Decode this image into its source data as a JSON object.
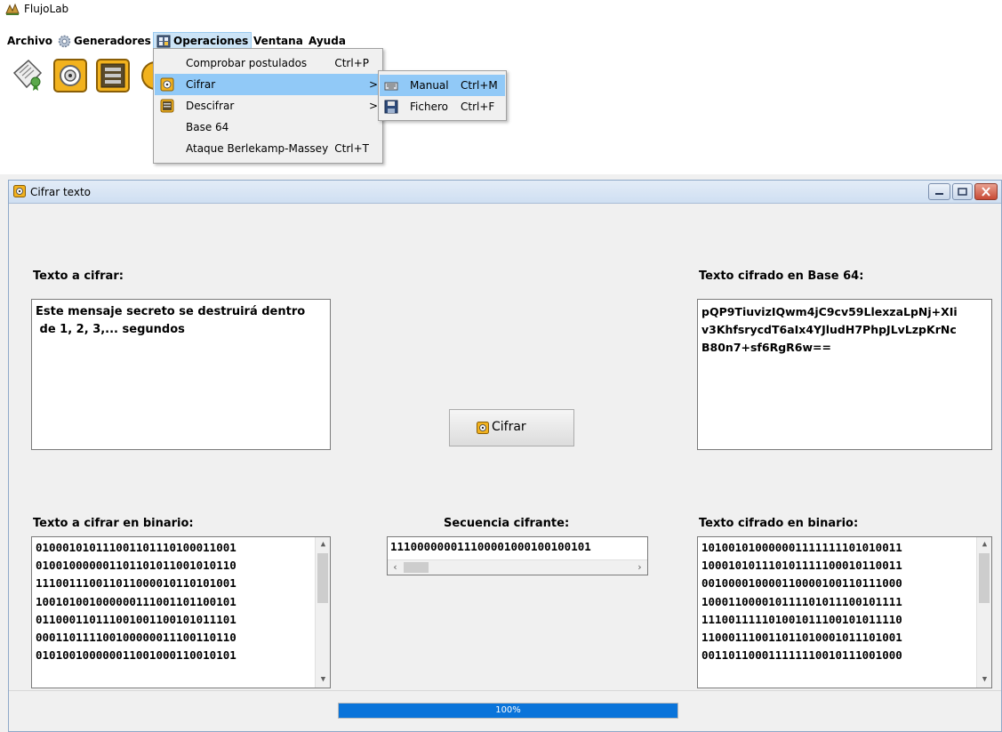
{
  "app": {
    "title": "FlujoLab"
  },
  "menubar": {
    "items": [
      {
        "label": "Archivo"
      },
      {
        "label": "Generadores"
      },
      {
        "label": "Operaciones"
      },
      {
        "label": "Ventana"
      },
      {
        "label": "Ayuda"
      }
    ]
  },
  "dropdown": {
    "items": [
      {
        "label": "Comprobar postulados",
        "shortcut": "Ctrl+P"
      },
      {
        "label": "Cifrar",
        "arrow": ">"
      },
      {
        "label": "Descifrar",
        "arrow": ">"
      },
      {
        "label": "Base 64"
      },
      {
        "label": "Ataque Berlekamp-Massey",
        "shortcut": "Ctrl+T"
      }
    ]
  },
  "submenu": {
    "items": [
      {
        "label": "Manual",
        "shortcut": "Ctrl+M"
      },
      {
        "label": "Fichero",
        "shortcut": "Ctrl+F"
      }
    ]
  },
  "frame": {
    "title": "Cifrar texto",
    "plain_label": "Texto a cifrar:",
    "plain_text": "Este mensaje secreto se destruirá dentro\n de 1, 2, 3,... segundos",
    "cipher_label": "Texto cifrado en Base 64:",
    "cipher_text": "pQP9TiuvizIQwm4jC9cv59LlexzaLpNj+XIi\nv3KhfsrycdT6aIx4YJludH7PhpJLvLzpKrNc\nB80n7+sf6RgR6w==",
    "button_label": "Cifrar",
    "plain_bin_label": "Texto a cifrar en binario:",
    "plain_bin": "010001010111001101110100011001\n010010000001101101011001010110\n111001110011011000010110101001\n100101001000000111001101100101\n011000110111001001100101011101\n000110111100100000011100110110\n010100100000011001000110010101",
    "seq_label": "Secuencia cifrante:",
    "seq_value": "111000000011100001000100100101",
    "cipher_bin_label": "Texto cifrado en binario:",
    "cipher_bin": "101001010000001111111101010011\n100010101110101111100010110011\n001000010000110000100110111000\n100011000010111101011100101111\n111001111101001011100101011110\n110001110011011010001011101001\n001101100011111110010111001000",
    "progress": {
      "value": 1.0,
      "label": "100%"
    }
  },
  "colors": {
    "accent": "#0a74da",
    "menu_hover": "#91c9f7"
  }
}
